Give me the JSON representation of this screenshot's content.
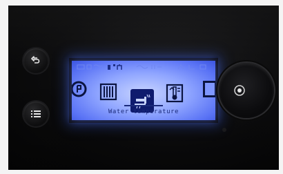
{
  "device": {
    "panel_color": "#0b0b0c",
    "lcd_color": "#8ea4ff"
  },
  "screen": {
    "label": "Water temperature",
    "selected_icon": "tap-icon"
  },
  "controls": {
    "back_button_icon": "back-arrow-icon",
    "menu_button_icon": "list-icon",
    "knob_icon": "knob-dot-icon"
  }
}
